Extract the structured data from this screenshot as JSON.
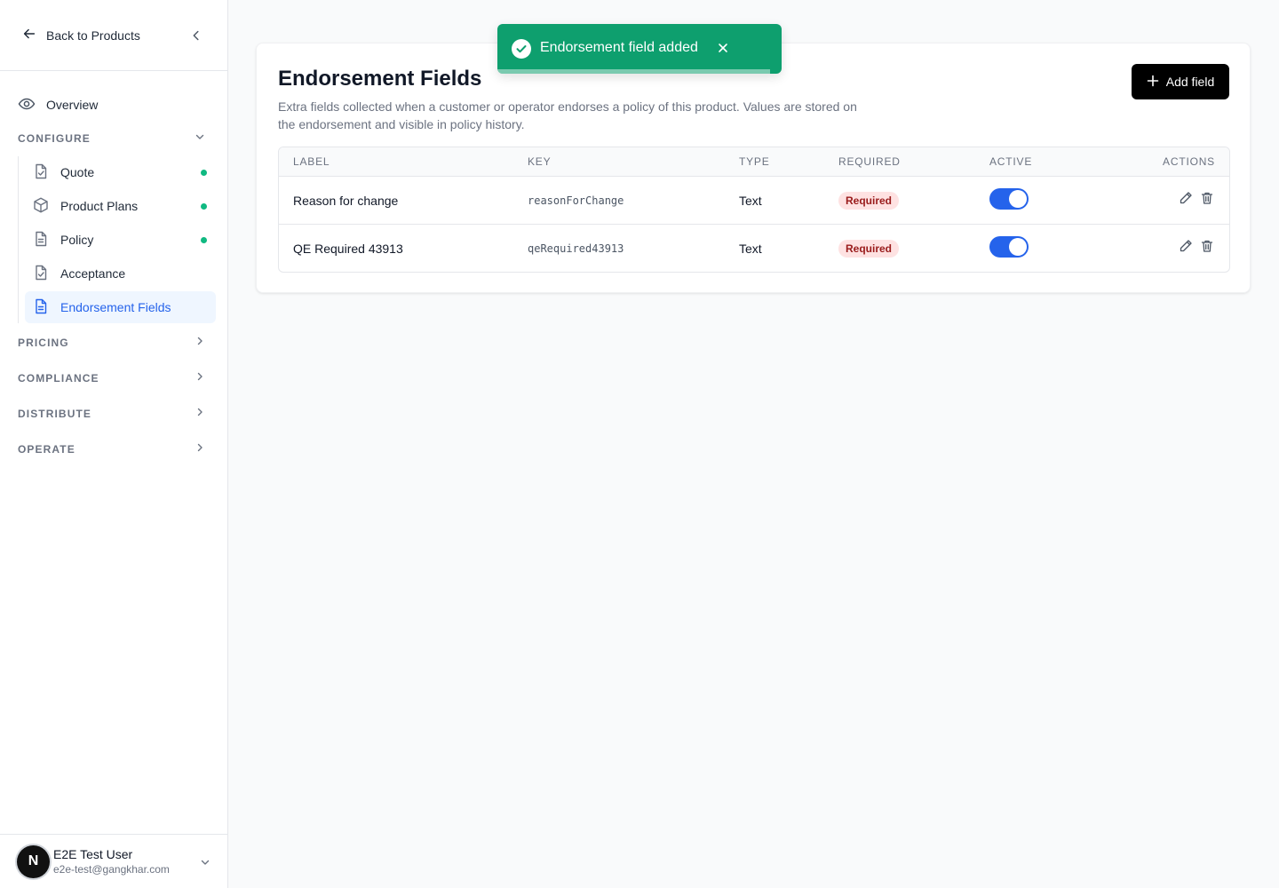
{
  "sidebar": {
    "back_label": "Back to Products",
    "overview_label": "Overview",
    "configure": {
      "label": "CONFIGURE",
      "items": [
        {
          "label": "Quote",
          "complete": true
        },
        {
          "label": "Product Plans",
          "complete": true
        },
        {
          "label": "Policy",
          "complete": true
        },
        {
          "label": "Acceptance",
          "complete": false
        },
        {
          "label": "Endorsement Fields",
          "complete": false,
          "active": true
        }
      ]
    },
    "sections": [
      "PRICING",
      "COMPLIANCE",
      "DISTRIBUTE",
      "OPERATE"
    ],
    "user": {
      "initial": "N",
      "name": "E2E Test User",
      "email": "e2e-test@gangkhar.com"
    }
  },
  "main": {
    "title": "Endorsement Fields",
    "description": "Extra fields collected when a customer or operator endorses a policy of this product. Values are stored on the endorsement and visible in policy history.",
    "add_button": "Add field",
    "table": {
      "columns": [
        "LABEL",
        "KEY",
        "TYPE",
        "REQUIRED",
        "ACTIVE",
        "ACTIONS"
      ],
      "rows": [
        {
          "label": "Reason for change",
          "key": "reasonForChange",
          "type": "Text",
          "required": "Required",
          "active": true
        },
        {
          "label": "QE Required 43913",
          "key": "qeRequired43913",
          "type": "Text",
          "required": "Required",
          "active": true
        }
      ]
    }
  },
  "toast": {
    "message": "Endorsement field added",
    "progress": 0.96
  },
  "colors": {
    "accent": "#2563eb",
    "success": "#0e9f6e",
    "status_dot": "#10b981",
    "badge_bg": "#fee2e2",
    "badge_text": "#991b1b"
  }
}
